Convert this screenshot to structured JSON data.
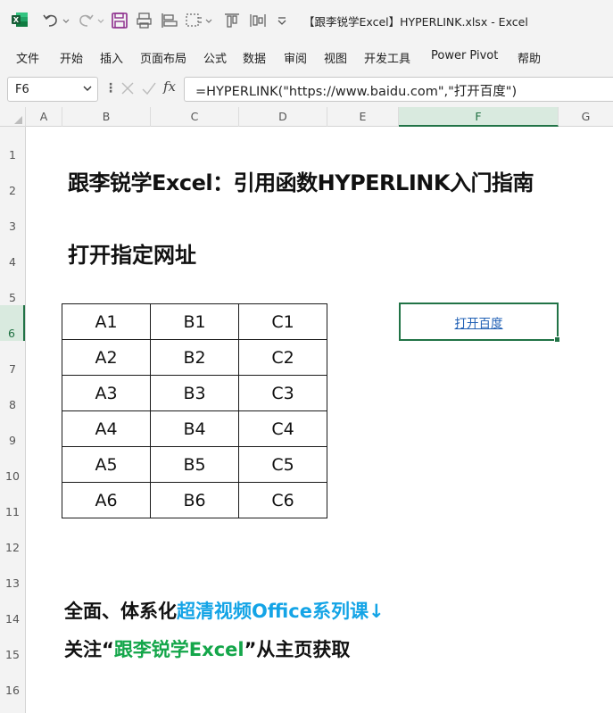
{
  "window": {
    "title": "【跟李锐学Excel】HYPERLINK.xlsx  -  Excel"
  },
  "colors": {
    "excel_green": "#217346",
    "link_blue": "#1f5fb4",
    "promo_blue": "#14a4e6",
    "promo_green": "#14a64a"
  },
  "quick_access": {
    "icons": [
      "excel-logo-icon",
      "undo-icon",
      "redo-icon",
      "save-icon",
      "print-preview-icon",
      "align-left-icon",
      "select-icon",
      "align-top-icon",
      "distribute-icon",
      "customize-icon"
    ]
  },
  "menu": {
    "items": [
      "文件",
      "开始",
      "插入",
      "页面布局",
      "公式",
      "数据",
      "审阅",
      "视图",
      "开发工具",
      "Power Pivot",
      "帮助"
    ]
  },
  "formula_bar": {
    "name_box": "F6",
    "formula": "=HYPERLINK(\"https://www.baidu.com\",\"打开百度\")",
    "fx_label": "fx"
  },
  "grid": {
    "columns": [
      "A",
      "B",
      "C",
      "D",
      "E",
      "F",
      "G"
    ],
    "rows": [
      "1",
      "2",
      "3",
      "4",
      "5",
      "6",
      "7",
      "8",
      "9",
      "10",
      "11",
      "12",
      "13",
      "14",
      "15",
      "16"
    ],
    "selected_column": "F",
    "selected_row": "6"
  },
  "sheet": {
    "title": "跟李锐学Excel：引用函数HYPERLINK入门指南",
    "subtitle": "打开指定网址",
    "table": [
      [
        "A1",
        "B1",
        "C1"
      ],
      [
        "A2",
        "B2",
        "C2"
      ],
      [
        "A3",
        "B3",
        "C3"
      ],
      [
        "A4",
        "B4",
        "C4"
      ],
      [
        "A5",
        "B5",
        "C5"
      ],
      [
        "A6",
        "B6",
        "C6"
      ]
    ],
    "link_text": "打开百度"
  },
  "promo": {
    "line1_prefix": "全面、体系化",
    "line1_highlight": "超清视频Office系列课↓",
    "line2_prefix": "关注“",
    "line2_highlight": "跟李锐学Excel",
    "line2_suffix": "”从主页获取"
  }
}
